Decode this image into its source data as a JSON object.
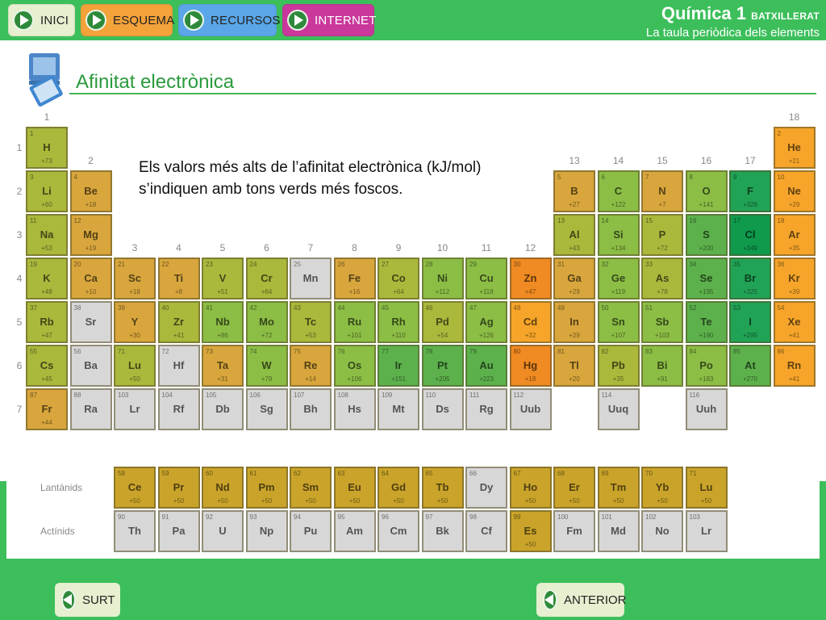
{
  "nav": {
    "inici": "INICI",
    "esquema": "ESQUEMA",
    "recursos": "RECURSOS",
    "internet": "INTERNET"
  },
  "header": {
    "course": "Química 1",
    "level": "BATXILLERAT",
    "unit": "La taula periòdica dels elements"
  },
  "section_title": "Afinitat electrònica",
  "caption": "Els valors més alts de l’afinitat electrònica (kJ/mol) s’indiquen amb tons verds més foscos.",
  "footer": {
    "surt": "SURT",
    "anterior": "ANTERIOR"
  },
  "table": {
    "group_labels": [
      "1",
      "2",
      "3",
      "4",
      "5",
      "6",
      "7",
      "8",
      "9",
      "10",
      "11",
      "12",
      "13",
      "14",
      "15",
      "16",
      "17",
      "18"
    ],
    "period_labels": [
      "1",
      "2",
      "3",
      "4",
      "5",
      "6",
      "7"
    ],
    "series_labels": [
      "Lantànids",
      "Actínids"
    ],
    "colors": {
      "olive": "#aab83c",
      "amber": "#d8a63c",
      "mustard": "#bfae3a",
      "lightgreen": "#8cbd45",
      "green": "#5db14c",
      "darkgreen": "#21a356",
      "deepgreen": "#0f9a4c",
      "orange": "#f08a22",
      "lightorange": "#f6a52a",
      "gold": "#caa42a",
      "grey": "#d7d7d7"
    },
    "elements": [
      {
        "sym": "H",
        "num": "1",
        "val": "+73",
        "g": 1,
        "p": 1,
        "c": "olive"
      },
      {
        "sym": "He",
        "num": "2",
        "val": "+21",
        "g": 18,
        "p": 1,
        "c": "lightorange"
      },
      {
        "sym": "Li",
        "num": "3",
        "val": "+60",
        "g": 1,
        "p": 2,
        "c": "olive"
      },
      {
        "sym": "Be",
        "num": "4",
        "val": "+18",
        "g": 2,
        "p": 2,
        "c": "amber"
      },
      {
        "sym": "B",
        "num": "5",
        "val": "+27",
        "g": 13,
        "p": 2,
        "c": "amber"
      },
      {
        "sym": "C",
        "num": "6",
        "val": "+122",
        "g": 14,
        "p": 2,
        "c": "lightgreen"
      },
      {
        "sym": "N",
        "num": "7",
        "val": "+7",
        "g": 15,
        "p": 2,
        "c": "amber"
      },
      {
        "sym": "O",
        "num": "8",
        "val": "+141",
        "g": 16,
        "p": 2,
        "c": "lightgreen"
      },
      {
        "sym": "F",
        "num": "9",
        "val": "+328",
        "g": 17,
        "p": 2,
        "c": "darkgreen"
      },
      {
        "sym": "Ne",
        "num": "10",
        "val": "+29",
        "g": 18,
        "p": 2,
        "c": "lightorange"
      },
      {
        "sym": "Na",
        "num": "11",
        "val": "+53",
        "g": 1,
        "p": 3,
        "c": "olive"
      },
      {
        "sym": "Mg",
        "num": "12",
        "val": "+19",
        "g": 2,
        "p": 3,
        "c": "amber"
      },
      {
        "sym": "Al",
        "num": "13",
        "val": "+43",
        "g": 13,
        "p": 3,
        "c": "olive"
      },
      {
        "sym": "Si",
        "num": "14",
        "val": "+134",
        "g": 14,
        "p": 3,
        "c": "lightgreen"
      },
      {
        "sym": "P",
        "num": "15",
        "val": "+72",
        "g": 15,
        "p": 3,
        "c": "olive"
      },
      {
        "sym": "S",
        "num": "16",
        "val": "+200",
        "g": 16,
        "p": 3,
        "c": "green"
      },
      {
        "sym": "Cl",
        "num": "17",
        "val": "+349",
        "g": 17,
        "p": 3,
        "c": "deepgreen"
      },
      {
        "sym": "Ar",
        "num": "18",
        "val": "+35",
        "g": 18,
        "p": 3,
        "c": "lightorange"
      },
      {
        "sym": "K",
        "num": "19",
        "val": "+48",
        "g": 1,
        "p": 4,
        "c": "olive"
      },
      {
        "sym": "Ca",
        "num": "20",
        "val": "+10",
        "g": 2,
        "p": 4,
        "c": "amber"
      },
      {
        "sym": "Sc",
        "num": "21",
        "val": "+18",
        "g": 3,
        "p": 4,
        "c": "amber"
      },
      {
        "sym": "Ti",
        "num": "22",
        "val": "+8",
        "g": 4,
        "p": 4,
        "c": "amber"
      },
      {
        "sym": "V",
        "num": "23",
        "val": "+51",
        "g": 5,
        "p": 4,
        "c": "olive"
      },
      {
        "sym": "Cr",
        "num": "24",
        "val": "+64",
        "g": 6,
        "p": 4,
        "c": "olive"
      },
      {
        "sym": "Mn",
        "num": "25",
        "val": "",
        "g": 7,
        "p": 4,
        "c": "grey"
      },
      {
        "sym": "Fe",
        "num": "26",
        "val": "+16",
        "g": 8,
        "p": 4,
        "c": "amber"
      },
      {
        "sym": "Co",
        "num": "27",
        "val": "+64",
        "g": 9,
        "p": 4,
        "c": "olive"
      },
      {
        "sym": "Ni",
        "num": "28",
        "val": "+112",
        "g": 10,
        "p": 4,
        "c": "lightgreen"
      },
      {
        "sym": "Cu",
        "num": "29",
        "val": "+118",
        "g": 11,
        "p": 4,
        "c": "lightgreen"
      },
      {
        "sym": "Zn",
        "num": "30",
        "val": "+47",
        "g": 12,
        "p": 4,
        "c": "orange"
      },
      {
        "sym": "Ga",
        "num": "31",
        "val": "+29",
        "g": 13,
        "p": 4,
        "c": "amber"
      },
      {
        "sym": "Ge",
        "num": "32",
        "val": "+119",
        "g": 14,
        "p": 4,
        "c": "lightgreen"
      },
      {
        "sym": "As",
        "num": "33",
        "val": "+78",
        "g": 15,
        "p": 4,
        "c": "olive"
      },
      {
        "sym": "Se",
        "num": "34",
        "val": "+195",
        "g": 16,
        "p": 4,
        "c": "green"
      },
      {
        "sym": "Br",
        "num": "35",
        "val": "+325",
        "g": 17,
        "p": 4,
        "c": "darkgreen"
      },
      {
        "sym": "Kr",
        "num": "36",
        "val": "+39",
        "g": 18,
        "p": 4,
        "c": "lightorange"
      },
      {
        "sym": "Rb",
        "num": "37",
        "val": "+47",
        "g": 1,
        "p": 5,
        "c": "olive"
      },
      {
        "sym": "Sr",
        "num": "38",
        "val": "",
        "g": 2,
        "p": 5,
        "c": "grey"
      },
      {
        "sym": "Y",
        "num": "39",
        "val": "+30",
        "g": 3,
        "p": 5,
        "c": "amber"
      },
      {
        "sym": "Zr",
        "num": "40",
        "val": "+41",
        "g": 4,
        "p": 5,
        "c": "olive"
      },
      {
        "sym": "Nb",
        "num": "41",
        "val": "+86",
        "g": 5,
        "p": 5,
        "c": "lightgreen"
      },
      {
        "sym": "Mo",
        "num": "42",
        "val": "+72",
        "g": 6,
        "p": 5,
        "c": "lightgreen"
      },
      {
        "sym": "Tc",
        "num": "43",
        "val": "+53",
        "g": 7,
        "p": 5,
        "c": "olive"
      },
      {
        "sym": "Ru",
        "num": "44",
        "val": "+101",
        "g": 8,
        "p": 5,
        "c": "lightgreen"
      },
      {
        "sym": "Rh",
        "num": "45",
        "val": "+110",
        "g": 9,
        "p": 5,
        "c": "lightgreen"
      },
      {
        "sym": "Pd",
        "num": "46",
        "val": "+54",
        "g": 10,
        "p": 5,
        "c": "olive"
      },
      {
        "sym": "Ag",
        "num": "47",
        "val": "+126",
        "g": 11,
        "p": 5,
        "c": "lightgreen"
      },
      {
        "sym": "Cd",
        "num": "48",
        "val": "+32",
        "g": 12,
        "p": 5,
        "c": "lightorange"
      },
      {
        "sym": "In",
        "num": "49",
        "val": "+29",
        "g": 13,
        "p": 5,
        "c": "amber"
      },
      {
        "sym": "Sn",
        "num": "50",
        "val": "+107",
        "g": 14,
        "p": 5,
        "c": "lightgreen"
      },
      {
        "sym": "Sb",
        "num": "51",
        "val": "+103",
        "g": 15,
        "p": 5,
        "c": "lightgreen"
      },
      {
        "sym": "Te",
        "num": "52",
        "val": "+190",
        "g": 16,
        "p": 5,
        "c": "green"
      },
      {
        "sym": "I",
        "num": "53",
        "val": "+295",
        "g": 17,
        "p": 5,
        "c": "darkgreen"
      },
      {
        "sym": "Xe",
        "num": "54",
        "val": "+41",
        "g": 18,
        "p": 5,
        "c": "lightorange"
      },
      {
        "sym": "Cs",
        "num": "55",
        "val": "+45",
        "g": 1,
        "p": 6,
        "c": "olive"
      },
      {
        "sym": "Ba",
        "num": "56",
        "val": "",
        "g": 2,
        "p": 6,
        "c": "grey"
      },
      {
        "sym": "Lu",
        "num": "71",
        "val": "+50",
        "g": 3,
        "p": 6,
        "c": "olive"
      },
      {
        "sym": "Hf",
        "num": "72",
        "val": "",
        "g": 4,
        "p": 6,
        "c": "grey"
      },
      {
        "sym": "Ta",
        "num": "73",
        "val": "+31",
        "g": 5,
        "p": 6,
        "c": "amber"
      },
      {
        "sym": "W",
        "num": "74",
        "val": "+79",
        "g": 6,
        "p": 6,
        "c": "lightgreen"
      },
      {
        "sym": "Re",
        "num": "75",
        "val": "+14",
        "g": 7,
        "p": 6,
        "c": "amber"
      },
      {
        "sym": "Os",
        "num": "76",
        "val": "+106",
        "g": 8,
        "p": 6,
        "c": "lightgreen"
      },
      {
        "sym": "Ir",
        "num": "77",
        "val": "+151",
        "g": 9,
        "p": 6,
        "c": "green"
      },
      {
        "sym": "Pt",
        "num": "78",
        "val": "+205",
        "g": 10,
        "p": 6,
        "c": "green"
      },
      {
        "sym": "Au",
        "num": "79",
        "val": "+223",
        "g": 11,
        "p": 6,
        "c": "green"
      },
      {
        "sym": "Hg",
        "num": "80",
        "val": "+18",
        "g": 12,
        "p": 6,
        "c": "orange"
      },
      {
        "sym": "Tl",
        "num": "81",
        "val": "+20",
        "g": 13,
        "p": 6,
        "c": "amber"
      },
      {
        "sym": "Pb",
        "num": "82",
        "val": "+35",
        "g": 14,
        "p": 6,
        "c": "olive"
      },
      {
        "sym": "Bi",
        "num": "83",
        "val": "+91",
        "g": 15,
        "p": 6,
        "c": "lightgreen"
      },
      {
        "sym": "Po",
        "num": "84",
        "val": "+183",
        "g": 16,
        "p": 6,
        "c": "lightgreen"
      },
      {
        "sym": "At",
        "num": "85",
        "val": "+270",
        "g": 17,
        "p": 6,
        "c": "green"
      },
      {
        "sym": "Rn",
        "num": "86",
        "val": "+41",
        "g": 18,
        "p": 6,
        "c": "lightorange"
      },
      {
        "sym": "Fr",
        "num": "87",
        "val": "+44",
        "g": 1,
        "p": 7,
        "c": "amber"
      },
      {
        "sym": "Ra",
        "num": "88",
        "val": "",
        "g": 2,
        "p": 7,
        "c": "grey"
      },
      {
        "sym": "Lr",
        "num": "103",
        "val": "",
        "g": 3,
        "p": 7,
        "c": "grey"
      },
      {
        "sym": "Rf",
        "num": "104",
        "val": "",
        "g": 4,
        "p": 7,
        "c": "grey"
      },
      {
        "sym": "Db",
        "num": "105",
        "val": "",
        "g": 5,
        "p": 7,
        "c": "grey"
      },
      {
        "sym": "Sg",
        "num": "106",
        "val": "",
        "g": 6,
        "p": 7,
        "c": "grey"
      },
      {
        "sym": "Bh",
        "num": "107",
        "val": "",
        "g": 7,
        "p": 7,
        "c": "grey"
      },
      {
        "sym": "Hs",
        "num": "108",
        "val": "",
        "g": 8,
        "p": 7,
        "c": "grey"
      },
      {
        "sym": "Mt",
        "num": "109",
        "val": "",
        "g": 9,
        "p": 7,
        "c": "grey"
      },
      {
        "sym": "Ds",
        "num": "110",
        "val": "",
        "g": 10,
        "p": 7,
        "c": "grey"
      },
      {
        "sym": "Rg",
        "num": "111",
        "val": "",
        "g": 11,
        "p": 7,
        "c": "grey"
      },
      {
        "sym": "Uub",
        "num": "112",
        "val": "",
        "g": 12,
        "p": 7,
        "c": "grey"
      },
      {
        "sym": "Uuq",
        "num": "114",
        "val": "",
        "g": 14,
        "p": 7,
        "c": "grey"
      },
      {
        "sym": "Uuh",
        "num": "116",
        "val": "",
        "g": 16,
        "p": 7,
        "c": "grey"
      }
    ],
    "lanthanides": [
      {
        "sym": "Ce",
        "num": "58",
        "val": "+50",
        "c": "gold"
      },
      {
        "sym": "Pr",
        "num": "59",
        "val": "+50",
        "c": "gold"
      },
      {
        "sym": "Nd",
        "num": "60",
        "val": "+50",
        "c": "gold"
      },
      {
        "sym": "Pm",
        "num": "61",
        "val": "+50",
        "c": "gold"
      },
      {
        "sym": "Sm",
        "num": "62",
        "val": "+50",
        "c": "gold"
      },
      {
        "sym": "Eu",
        "num": "63",
        "val": "+50",
        "c": "gold"
      },
      {
        "sym": "Gd",
        "num": "64",
        "val": "+50",
        "c": "gold"
      },
      {
        "sym": "Tb",
        "num": "65",
        "val": "+50",
        "c": "gold"
      },
      {
        "sym": "Dy",
        "num": "66",
        "val": "",
        "c": "grey"
      },
      {
        "sym": "Ho",
        "num": "67",
        "val": "+50",
        "c": "gold"
      },
      {
        "sym": "Er",
        "num": "68",
        "val": "+50",
        "c": "gold"
      },
      {
        "sym": "Tm",
        "num": "69",
        "val": "+50",
        "c": "gold"
      },
      {
        "sym": "Yb",
        "num": "70",
        "val": "+50",
        "c": "gold"
      },
      {
        "sym": "Lu",
        "num": "71",
        "val": "+50",
        "c": "gold"
      }
    ],
    "actinides": [
      {
        "sym": "Th",
        "num": "90",
        "val": "",
        "c": "grey"
      },
      {
        "sym": "Pa",
        "num": "91",
        "val": "",
        "c": "grey"
      },
      {
        "sym": "U",
        "num": "92",
        "val": "",
        "c": "grey"
      },
      {
        "sym": "Np",
        "num": "93",
        "val": "",
        "c": "grey"
      },
      {
        "sym": "Pu",
        "num": "94",
        "val": "",
        "c": "grey"
      },
      {
        "sym": "Am",
        "num": "95",
        "val": "",
        "c": "grey"
      },
      {
        "sym": "Cm",
        "num": "96",
        "val": "",
        "c": "grey"
      },
      {
        "sym": "Bk",
        "num": "97",
        "val": "",
        "c": "grey"
      },
      {
        "sym": "Cf",
        "num": "98",
        "val": "",
        "c": "grey"
      },
      {
        "sym": "Es",
        "num": "99",
        "val": "+50",
        "c": "gold"
      },
      {
        "sym": "Fm",
        "num": "100",
        "val": "",
        "c": "grey"
      },
      {
        "sym": "Md",
        "num": "101",
        "val": "",
        "c": "grey"
      },
      {
        "sym": "No",
        "num": "102",
        "val": "",
        "c": "grey"
      },
      {
        "sym": "Lr",
        "num": "103",
        "val": "",
        "c": "grey"
      }
    ]
  }
}
